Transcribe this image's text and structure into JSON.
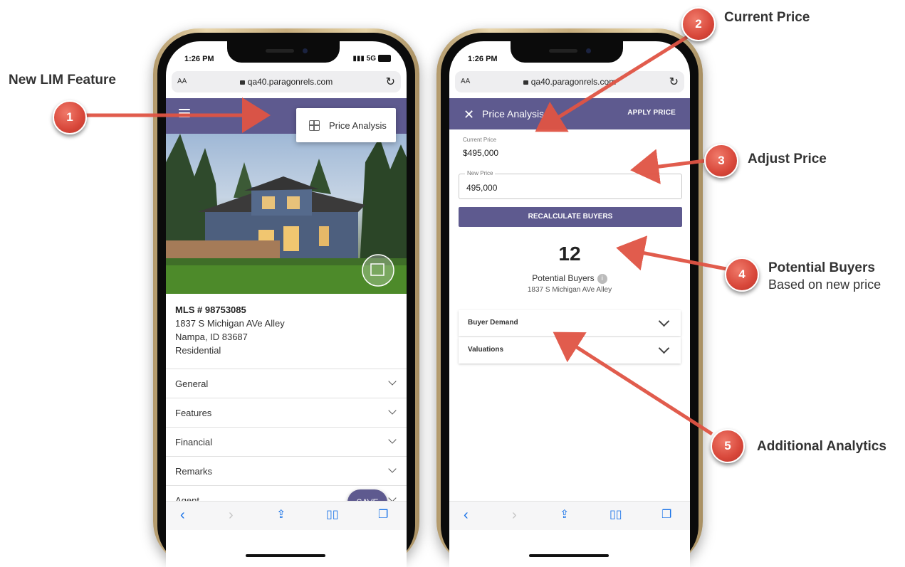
{
  "colors": {
    "header": "#5e5a8f",
    "annotation": "#d8473a",
    "link": "#1a73e8"
  },
  "status": {
    "time": "1:26 PM",
    "signal": "5G"
  },
  "browser": {
    "aa": "AA",
    "url": "qa40.paragonrels.com"
  },
  "left": {
    "menu_item": "Price Analysis",
    "listing": {
      "mls": "MLS # 98753085",
      "address": "1837 S Michigan AVe Alley",
      "city": "Nampa, ID 83687",
      "type": "Residential"
    },
    "sections": [
      "General",
      "Features",
      "Financial",
      "Remarks",
      "Agent"
    ],
    "save": "SAVE"
  },
  "right": {
    "title": "Price Analysis",
    "apply": "APPLY PRICE",
    "current_price_label": "Current Price",
    "current_price": "$495,000",
    "new_price_label": "New Price",
    "new_price": "495,000",
    "recalc": "RECALCULATE BUYERS",
    "buyer_count": "12",
    "buyers_label": "Potential Buyers",
    "buyers_address": "1837 S Michigan AVe Alley",
    "sections": [
      "Buyer Demand",
      "Valuations"
    ]
  },
  "annotations": {
    "a1": {
      "num": "1",
      "label": "New LIM Feature"
    },
    "a2": {
      "num": "2",
      "label": "Current Price"
    },
    "a3": {
      "num": "3",
      "label": "Adjust Price"
    },
    "a4": {
      "num": "4",
      "label": "Potential Buyers",
      "sub": "Based on new price"
    },
    "a5": {
      "num": "5",
      "label": "Additional Analytics"
    }
  }
}
